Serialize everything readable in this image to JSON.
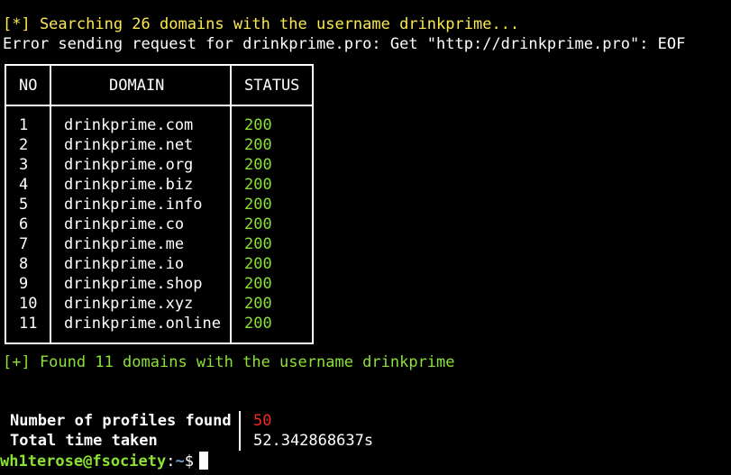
{
  "terminal": {
    "searching_line": "[*] Searching 26 domains with the username drinkprime...",
    "error_line": "Error sending request for drinkprime.pro: Get \"http://drinkprime.pro\": EOF",
    "table": {
      "headers": {
        "no": "NO",
        "domain": "DOMAIN",
        "status": "STATUS"
      },
      "rows": [
        {
          "no": "1",
          "domain": "drinkprime.com",
          "status": "200"
        },
        {
          "no": "2",
          "domain": "drinkprime.net",
          "status": "200"
        },
        {
          "no": "3",
          "domain": "drinkprime.org",
          "status": "200"
        },
        {
          "no": "4",
          "domain": "drinkprime.biz",
          "status": "200"
        },
        {
          "no": "5",
          "domain": "drinkprime.info",
          "status": "200"
        },
        {
          "no": "6",
          "domain": "drinkprime.co",
          "status": "200"
        },
        {
          "no": "7",
          "domain": "drinkprime.me",
          "status": "200"
        },
        {
          "no": "8",
          "domain": "drinkprime.io",
          "status": "200"
        },
        {
          "no": "9",
          "domain": "drinkprime.shop",
          "status": "200"
        },
        {
          "no": "10",
          "domain": "drinkprime.xyz",
          "status": "200"
        },
        {
          "no": "11",
          "domain": "drinkprime.online",
          "status": "200"
        }
      ]
    },
    "found_line": "[+] Found 11 domains with the username drinkprime",
    "summary": {
      "profiles_label": "Number of profiles found",
      "profiles_value": "50",
      "time_label": "Total time taken",
      "time_value": "52.342868637s"
    },
    "prompt": {
      "user_host": "wh1terose@fsociety",
      "separator": ":",
      "path": "~",
      "symbol": "$"
    }
  },
  "colors": {
    "background": "#000000",
    "text": "#ffffff",
    "yellow": "#fce94f",
    "green": "#8ae234",
    "red": "#ef2929",
    "prompt_path": "#729fcf"
  }
}
